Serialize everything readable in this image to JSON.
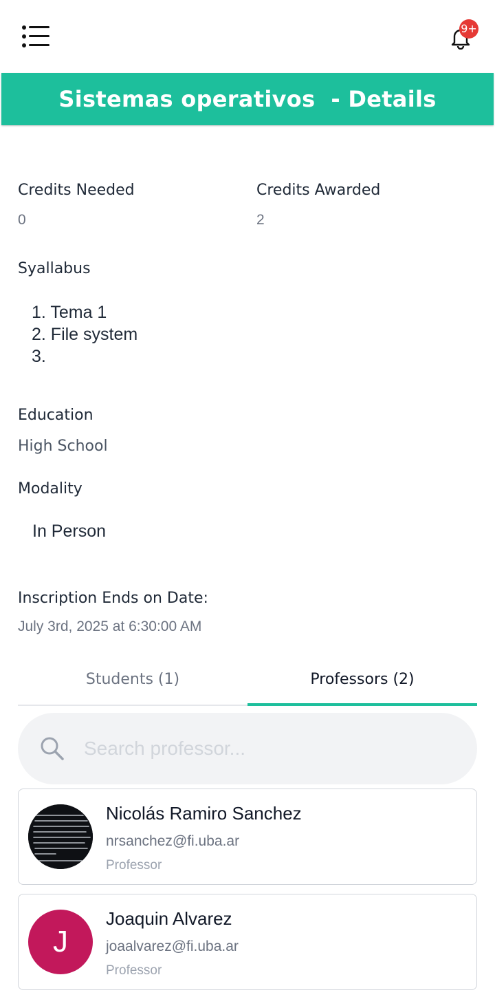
{
  "header": {
    "menu_icon": "menu-icon",
    "bell_icon": "bell-icon",
    "notification_badge": "9+"
  },
  "title": "Sistemas operativos  - Details",
  "credits": {
    "needed_label": "Credits Needed",
    "needed_value": "0",
    "awarded_label": "Credits Awarded",
    "awarded_value": "2"
  },
  "syllabus": {
    "label": "Syallabus",
    "items": [
      "1. Tema 1",
      "2. File system",
      "3."
    ]
  },
  "education": {
    "label": "Education",
    "value": "High School"
  },
  "modality": {
    "label": "Modality",
    "value": "In Person"
  },
  "inscription": {
    "label": "Inscription Ends on Date:",
    "value": "July 3rd, 2025 at 6:30:00 AM"
  },
  "tabs": [
    {
      "label": "Students (1)",
      "active": false
    },
    {
      "label": "Professors (2)",
      "active": true
    }
  ],
  "search": {
    "placeholder": "Search professor...",
    "value": ""
  },
  "professors": [
    {
      "name": "Nicolás Ramiro Sanchez",
      "email": "nrsanchez@fi.uba.ar",
      "role": "Professor",
      "avatar": "photo"
    },
    {
      "name": "Joaquin Alvarez",
      "email": "joaalvarez@fi.uba.ar",
      "role": "Professor",
      "avatar_initial": "J"
    }
  ],
  "colors": {
    "accent": "#1dbf9c",
    "badge": "#e53935",
    "avatar_initial_bg": "#c2185b"
  }
}
